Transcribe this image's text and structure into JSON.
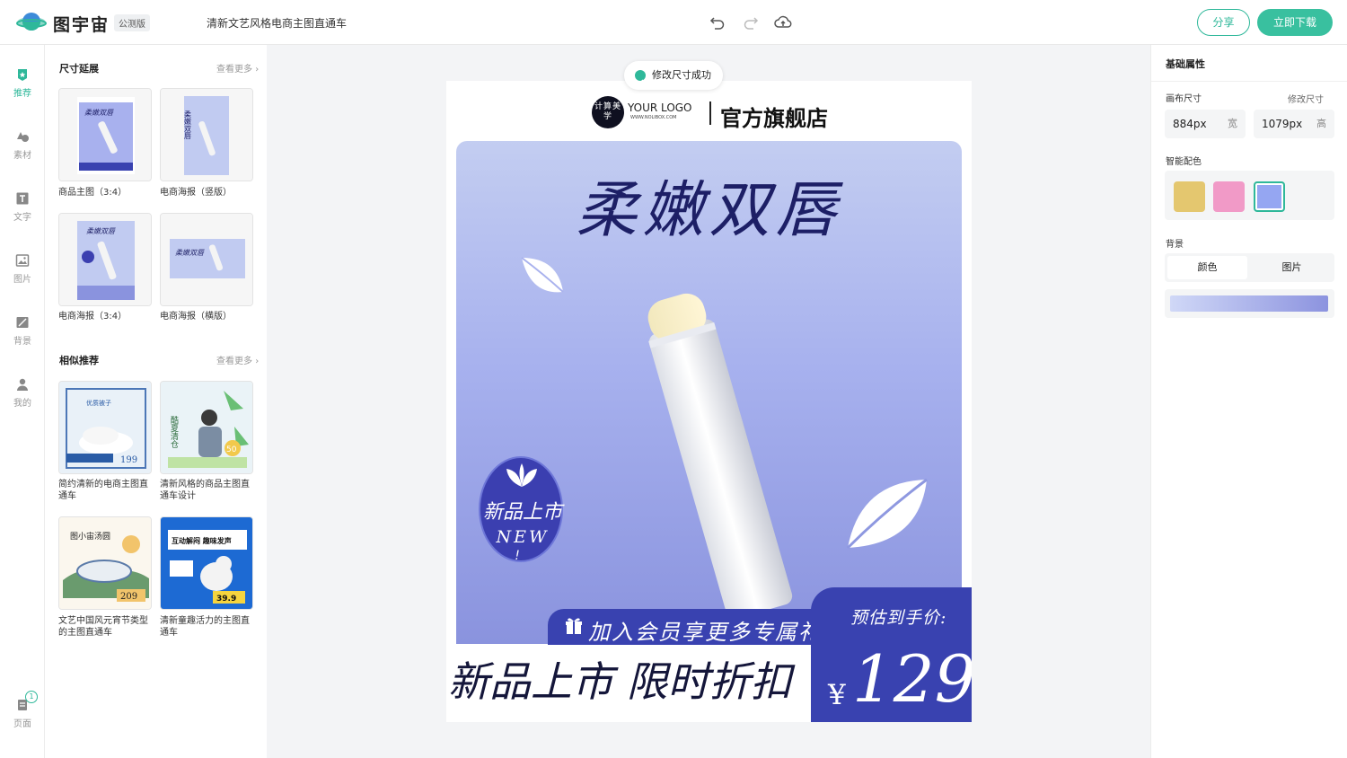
{
  "header": {
    "brand": "图宇宙",
    "beta_badge": "公测版",
    "document_title": "清新文艺风格电商主图直通车",
    "share_label": "分享",
    "download_label": "立即下载",
    "icons": [
      "undo-icon",
      "redo-icon",
      "cloud-upload-icon"
    ]
  },
  "rail": {
    "items": [
      {
        "label": "推荐",
        "icon": "recommend-icon",
        "active": true
      },
      {
        "label": "素材",
        "icon": "shapes-icon"
      },
      {
        "label": "文字",
        "icon": "text-icon"
      },
      {
        "label": "图片",
        "icon": "image-icon"
      },
      {
        "label": "背景",
        "icon": "background-icon"
      },
      {
        "label": "我的",
        "icon": "user-icon"
      }
    ],
    "pages": {
      "label": "页面",
      "count": "1"
    }
  },
  "panel": {
    "size_section": {
      "title": "尺寸延展",
      "more": "查看更多",
      "items": [
        {
          "label": "商品主图（3:4）",
          "thumb_text": "柔嫩双唇"
        },
        {
          "label": "电商海报（竖版）",
          "thumb_text": "柔嫩双唇"
        },
        {
          "label": "电商海报（3:4）",
          "thumb_text": "柔嫩双唇"
        },
        {
          "label": "电商海报（横版）",
          "thumb_text": "柔嫩双唇"
        }
      ]
    },
    "similar_section": {
      "title": "相似推荐",
      "more": "查看更多",
      "items": [
        {
          "label": "简约清新的电商主图直通车",
          "thumb_text": "优质被子",
          "price": "199"
        },
        {
          "label": "清新风格的商品主图直通车设计",
          "thumb_text": "酷夏清仓",
          "price": "50"
        },
        {
          "label": "文艺中国风元宵节类型的主图直通车",
          "thumb_text": "图小宙汤圆",
          "price": "209"
        },
        {
          "label": "清新童趣活力的主图直通车",
          "thumb_text": "互动解闷 趣味发声",
          "price": "39.9"
        }
      ]
    }
  },
  "canvas": {
    "toast": "修改尺寸成功",
    "poster": {
      "logo_mark": "计算美学",
      "logo_text": "YOUR LOGO",
      "logo_sub": "WWW.NOLIBOX.COM",
      "shop": "官方旗舰店",
      "title": "柔嫩双唇",
      "badge_line1": "新品上市",
      "badge_line2": "NEW",
      "badge_line3": "!",
      "member_band": "加入会员享更多专属礼遇",
      "price_label": "预估到手价:",
      "currency": "¥",
      "price": "129",
      "bottom_slogan": "新品上市 限时折扣"
    }
  },
  "properties": {
    "title": "基础属性",
    "canvas_size_label": "画布尺寸",
    "modify_size_link": "修改尺寸",
    "width_value": "884px",
    "width_unit": "宽",
    "height_value": "1079px",
    "height_unit": "高",
    "smart_color_label": "智能配色",
    "swatches": [
      "#e4c76f",
      "#f19ac7",
      "#95a6f2"
    ],
    "background_label": "背景",
    "bg_tab_color": "颜色",
    "bg_tab_image": "图片",
    "gradient": [
      "#d0d8f7",
      "#8c93df"
    ]
  }
}
